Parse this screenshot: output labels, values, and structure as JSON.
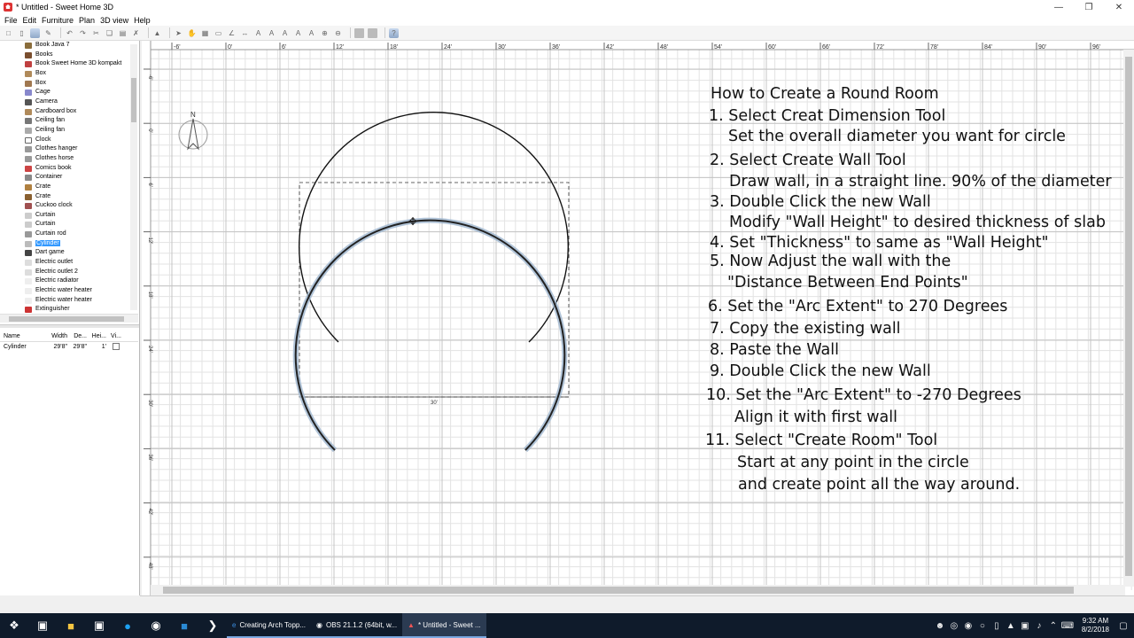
{
  "window": {
    "title": "* Untitled - Sweet Home 3D"
  },
  "menu": [
    "File",
    "Edit",
    "Furniture",
    "Plan",
    "3D view",
    "Help"
  ],
  "catalog": {
    "items": [
      {
        "label": "Book Java 7"
      },
      {
        "label": "Books"
      },
      {
        "label": "Book Sweet Home 3D kompakt"
      },
      {
        "label": "Box"
      },
      {
        "label": "Box"
      },
      {
        "label": "Cage"
      },
      {
        "label": "Camera"
      },
      {
        "label": "Cardboard box"
      },
      {
        "label": "Ceiling fan"
      },
      {
        "label": "Ceiling fan"
      },
      {
        "label": "Clock"
      },
      {
        "label": "Clothes hanger"
      },
      {
        "label": "Clothes horse"
      },
      {
        "label": "Comics book"
      },
      {
        "label": "Container"
      },
      {
        "label": "Crate"
      },
      {
        "label": "Crate"
      },
      {
        "label": "Cuckoo clock"
      },
      {
        "label": "Curtain"
      },
      {
        "label": "Curtain"
      },
      {
        "label": "Curtain rod"
      },
      {
        "label": "Cylinder",
        "selected": true
      },
      {
        "label": "Dart game"
      },
      {
        "label": "Electric outlet"
      },
      {
        "label": "Electric outlet 2"
      },
      {
        "label": "Electric radiator"
      },
      {
        "label": "Electric water heater"
      },
      {
        "label": "Electric water heater"
      },
      {
        "label": "Extinguisher"
      }
    ]
  },
  "furniture_table": {
    "headers": [
      "Name",
      "Width",
      "De...",
      "Hei...",
      "Vi..."
    ],
    "rows": [
      {
        "name": "Cylinder",
        "width": "29'8\"",
        "depth": "29'8\"",
        "height": "1'",
        "visible": "checkbox"
      }
    ]
  },
  "ruler": {
    "top": [
      "-6'",
      "0'",
      "6'",
      "12'",
      "18'",
      "24'",
      "30'",
      "36'",
      "42'",
      "48'",
      "54'",
      "60'",
      "66'",
      "72'",
      "78'",
      "84'",
      "90'",
      "96'"
    ],
    "left": [
      "-6'",
      "0'",
      "6'",
      "12'",
      "18'",
      "24'",
      "30'",
      "36'",
      "42'",
      "48'"
    ]
  },
  "plan": {
    "compass": "N",
    "dimension_label": "30'"
  },
  "instructions": {
    "title": "How to Create a Round Room",
    "lines": [
      "1. Select Creat Dimension Tool",
      "Set the overall diameter you want for circle",
      "2. Select Create Wall Tool",
      "Draw wall, in a straight line. 90% of the diameter",
      "3. Double Click the new Wall",
      "Modify \"Wall Height\" to desired thickness of slab",
      "4. Set \"Thickness\" to same as \"Wall Height\"",
      "5. Now Adjust the wall with the",
      "\"Distance Between End Points\"",
      "6. Set the \"Arc Extent\" to 270 Degrees",
      "7. Copy the existing wall",
      "8. Paste the Wall",
      "9. Double Click the new Wall",
      "10. Set the \"Arc Extent\" to -270 Degrees",
      "Align it with first wall",
      "11. Select \"Create Room\" Tool",
      "Start at any point in the circle",
      "and create point all the way around."
    ]
  },
  "taskbar": {
    "apps": [
      "Creating Arch Topp...",
      "OBS 21.1.2 (64bit, w...",
      "* Untitled - Sweet ..."
    ],
    "time": "9:32 AM",
    "date": "8/2/2018"
  }
}
